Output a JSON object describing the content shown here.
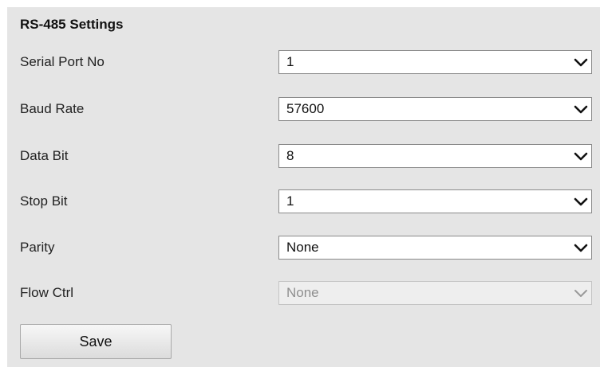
{
  "section": {
    "title": "RS-485 Settings"
  },
  "fields": {
    "serial_port_no": {
      "label": "Serial Port No",
      "value": "1"
    },
    "baud_rate": {
      "label": "Baud Rate",
      "value": "57600"
    },
    "data_bit": {
      "label": "Data Bit",
      "value": "8"
    },
    "stop_bit": {
      "label": "Stop Bit",
      "value": "1"
    },
    "parity": {
      "label": "Parity",
      "value": "None"
    },
    "flow_ctrl": {
      "label": "Flow Ctrl",
      "value": "None",
      "disabled": true
    }
  },
  "actions": {
    "save_label": "Save"
  },
  "icons": {
    "dropdown": "chevron-down-icon"
  },
  "colors": {
    "panel_background": "#e5e5e5",
    "disabled_text": "#8f8f8f"
  }
}
